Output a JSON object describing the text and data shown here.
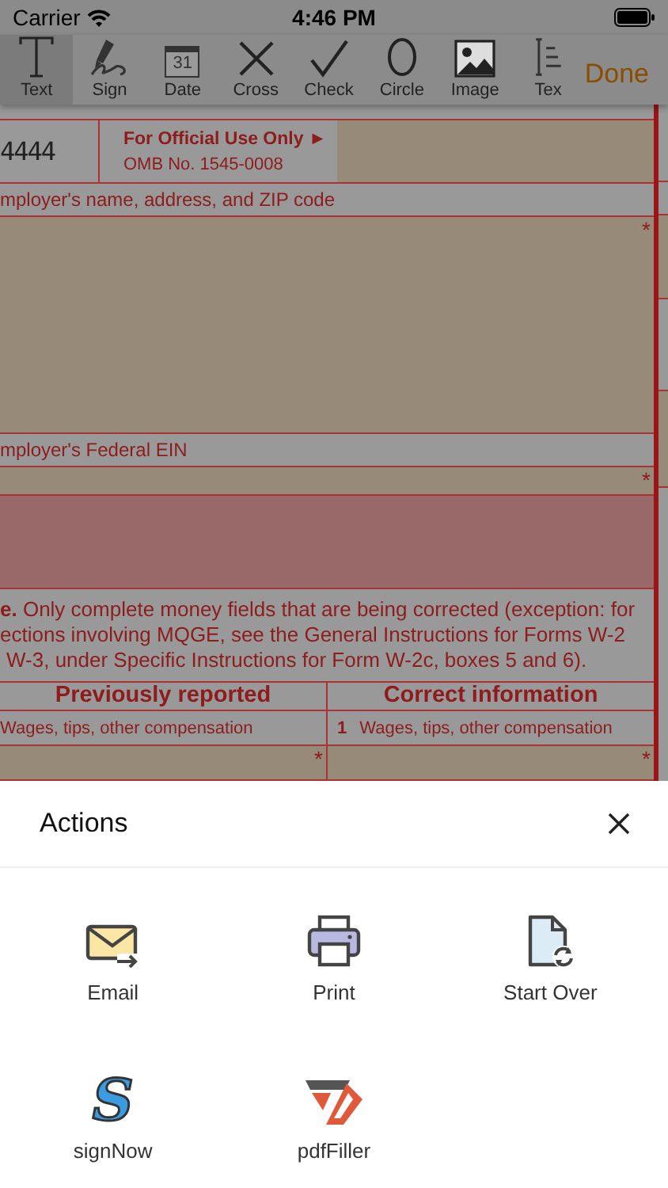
{
  "status_bar": {
    "carrier": "Carrier",
    "time": "4:46 PM"
  },
  "toolbar": {
    "tools": [
      {
        "kind": "text",
        "label": "Text",
        "selected": true
      },
      {
        "kind": "sign",
        "label": "Sign",
        "selected": false
      },
      {
        "kind": "date",
        "label": "Date",
        "selected": false,
        "icon_text": "31"
      },
      {
        "kind": "cross",
        "label": "Cross",
        "selected": false
      },
      {
        "kind": "check",
        "label": "Check",
        "selected": false
      },
      {
        "kind": "circle",
        "label": "Circle",
        "selected": false
      },
      {
        "kind": "image",
        "label": "Image",
        "selected": false
      },
      {
        "kind": "textfield",
        "label": "Tex",
        "selected": false
      }
    ],
    "done": "Done"
  },
  "form": {
    "id_cell": "4444",
    "official_title": "For Official Use Only ►",
    "omb": "OMB No. 1545-0008",
    "employer_name": {
      "label": "mployer's name, address, and ZIP code",
      "required_mark": "*"
    },
    "ein": {
      "label": "mployer's Federal EIN",
      "required_mark": "*"
    },
    "note_lines": [
      "**e.** Only complete money fields that are being corrected (exception: for",
      "ections involving MQGE, see the General Instructions for Forms W-2",
      "W-3, under Specific Instructions for Form W-2c, boxes 5 and 6)."
    ],
    "columns": [
      {
        "heading": "Previously reported",
        "field": {
          "label": "Wages, tips, other compensation",
          "required_mark": "*"
        }
      },
      {
        "heading": "Correct information",
        "field": {
          "number": "1",
          "label": "Wages, tips, other compensation",
          "required_mark": "*"
        }
      }
    ]
  },
  "actions": {
    "title": "Actions",
    "items": [
      {
        "kind": "email",
        "label": "Email"
      },
      {
        "kind": "print",
        "label": "Print"
      },
      {
        "kind": "startover",
        "label": "Start Over"
      },
      {
        "kind": "signnow",
        "label": "signNow",
        "glyph": "S"
      },
      {
        "kind": "pdffiller",
        "label": "pdfFiller"
      }
    ]
  }
}
